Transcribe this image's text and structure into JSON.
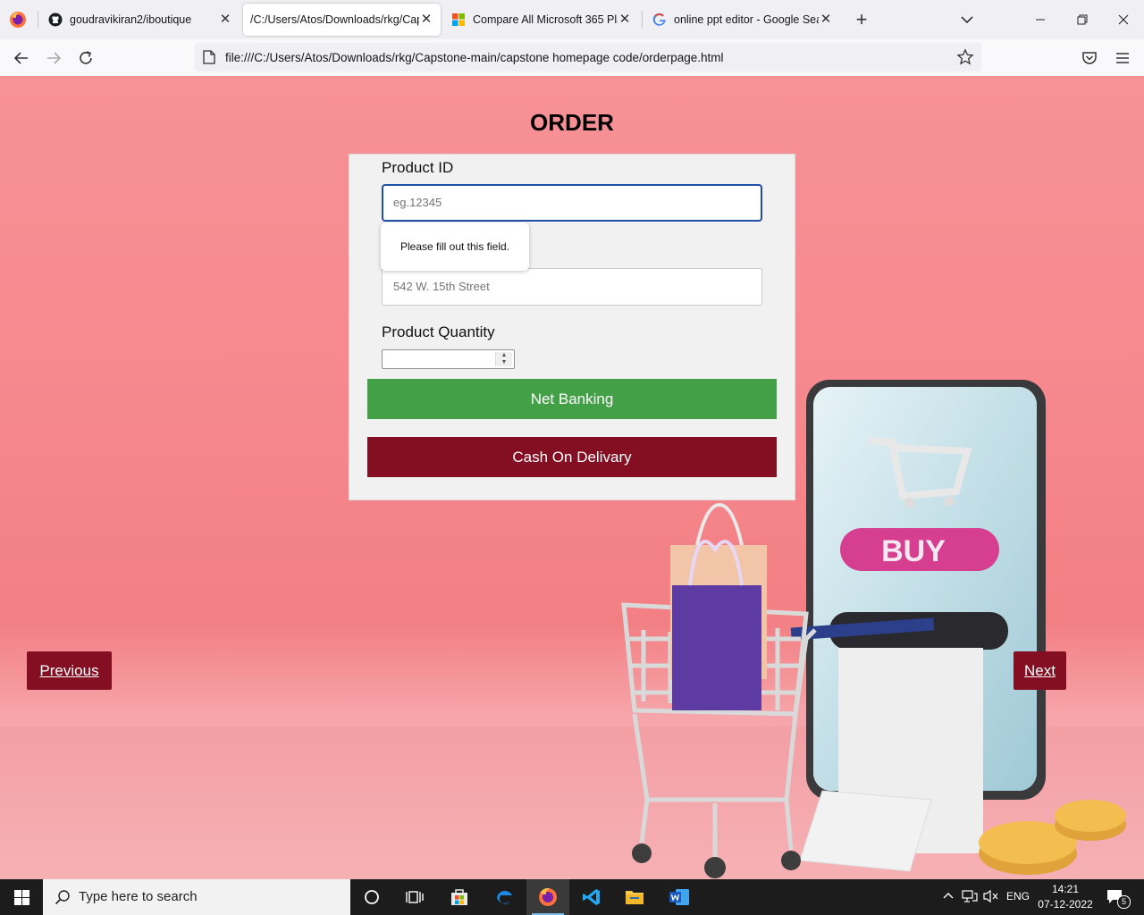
{
  "browser": {
    "tabs": [
      {
        "title": "goudravikiran2/iboutique",
        "icon": "github-icon"
      },
      {
        "title": "/C:/Users/Atos/Downloads/rkg/Cap",
        "icon": "none"
      },
      {
        "title": "Compare All Microsoft 365 Plan",
        "icon": "microsoft-icon"
      },
      {
        "title": "online ppt editor - Google Searc",
        "icon": "google-icon"
      }
    ],
    "active_tab_index": 1,
    "url": "file:///C:/Users/Atos/Downloads/rkg/Capstone-main/capstone homepage code/orderpage.html"
  },
  "page": {
    "title": "ORDER",
    "product_id": {
      "label": "Product ID",
      "placeholder": "eg.12345"
    },
    "address": {
      "placeholder": "542 W. 15th Street"
    },
    "quantity": {
      "label": "Product Quantity"
    },
    "net_banking_label": "Net Banking",
    "cash_on_delivery_label": "Cash On Delivary",
    "validation_tooltip": "Please fill out this field.",
    "previous_label": "Previous",
    "next_label": "Next",
    "buy_sign": "BUY"
  },
  "taskbar": {
    "search_placeholder": "Type here to search",
    "language": "ENG",
    "time": "14:21",
    "date": "07-12-2022",
    "notification_count": "5"
  },
  "colors": {
    "net_banking": "#43a047",
    "cash_on_delivery": "#850f22",
    "focus_border": "#1f4fa8"
  }
}
